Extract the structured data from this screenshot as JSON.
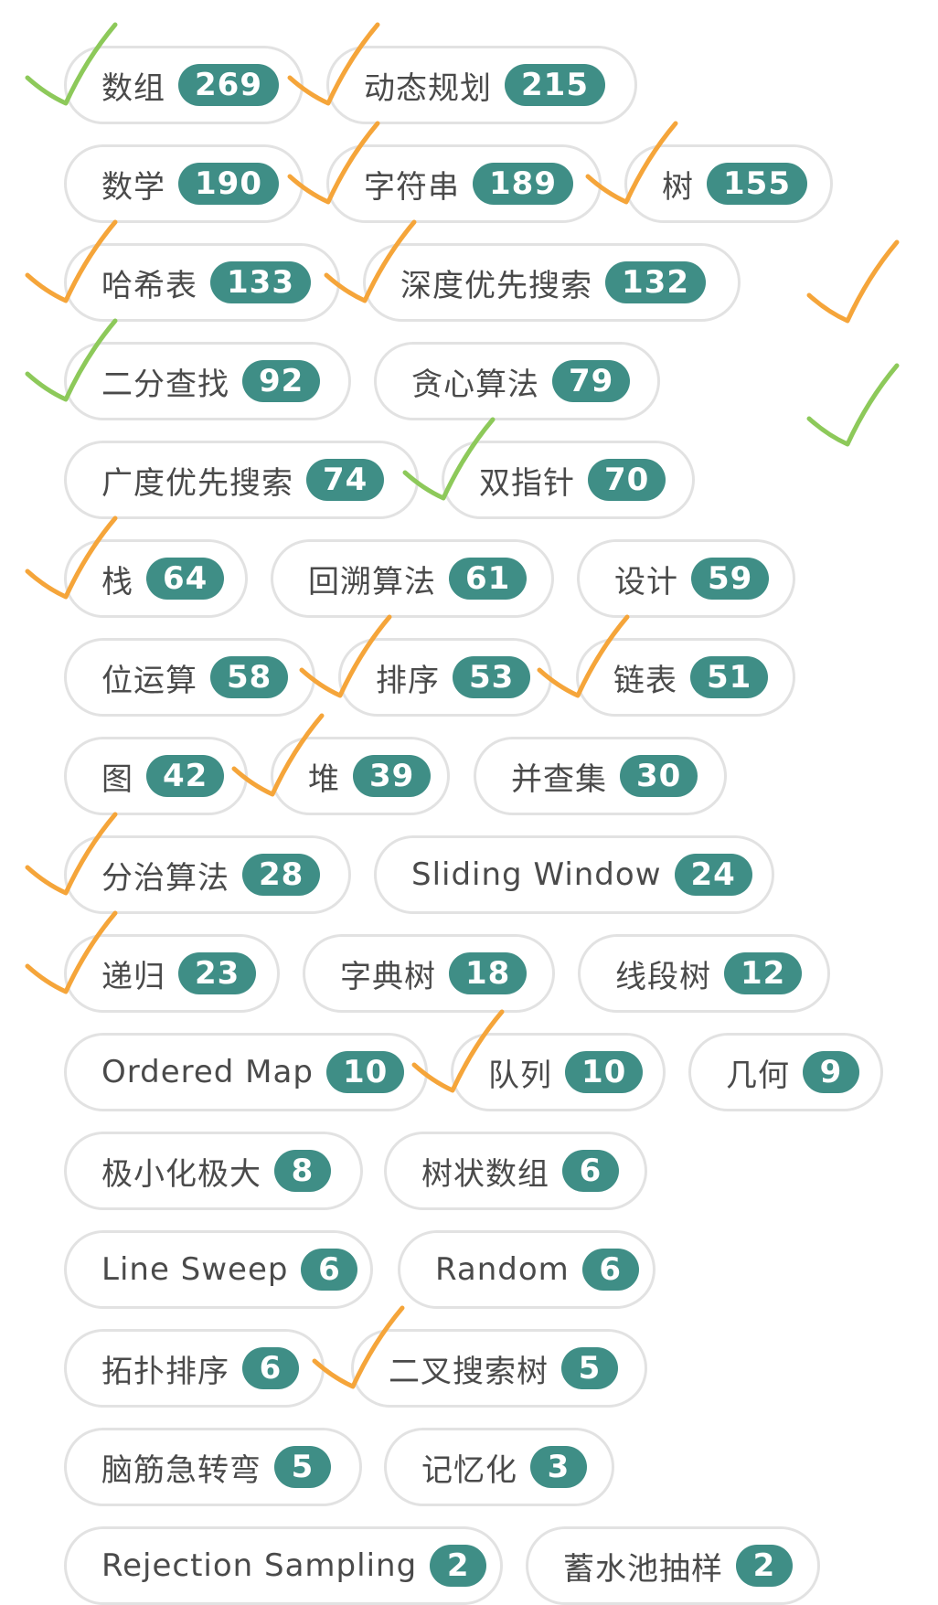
{
  "colors": {
    "accent": "#3f8e86",
    "orange_check": "#f5a53a",
    "green_check": "#8dc95a",
    "border": "#e2e2e2",
    "label": "#4a4a4a"
  },
  "tags": [
    {
      "label": "数组",
      "count": "269",
      "check": "green"
    },
    {
      "label": "动态规划",
      "count": "215",
      "check": "orange"
    },
    {
      "label": "数学",
      "count": "190",
      "check": null
    },
    {
      "label": "字符串",
      "count": "189",
      "check": "orange"
    },
    {
      "label": "树",
      "count": "155",
      "check": "orange"
    },
    {
      "label": "哈希表",
      "count": "133",
      "check": "orange"
    },
    {
      "label": "深度优先搜索",
      "count": "132",
      "check": "orange"
    },
    {
      "label": "二分查找",
      "count": "92",
      "check": "green"
    },
    {
      "label": "贪心算法",
      "count": "79",
      "check": null
    },
    {
      "label": "广度优先搜索",
      "count": "74",
      "check": null
    },
    {
      "label": "双指针",
      "count": "70",
      "check": "green"
    },
    {
      "label": "栈",
      "count": "64",
      "check": "orange"
    },
    {
      "label": "回溯算法",
      "count": "61",
      "check": null
    },
    {
      "label": "设计",
      "count": "59",
      "check": null
    },
    {
      "label": "位运算",
      "count": "58",
      "check": null
    },
    {
      "label": "排序",
      "count": "53",
      "check": "orange"
    },
    {
      "label": "链表",
      "count": "51",
      "check": "orange"
    },
    {
      "label": "图",
      "count": "42",
      "check": null
    },
    {
      "label": "堆",
      "count": "39",
      "check": "orange"
    },
    {
      "label": "并查集",
      "count": "30",
      "check": null
    },
    {
      "label": "分治算法",
      "count": "28",
      "check": "orange"
    },
    {
      "label": "Sliding Window",
      "count": "24",
      "check": null
    },
    {
      "label": "递归",
      "count": "23",
      "check": "orange"
    },
    {
      "label": "字典树",
      "count": "18",
      "check": null
    },
    {
      "label": "线段树",
      "count": "12",
      "check": null
    },
    {
      "label": "Ordered Map",
      "count": "10",
      "check": null
    },
    {
      "label": "队列",
      "count": "10",
      "check": "orange"
    },
    {
      "label": "几何",
      "count": "9",
      "check": null
    },
    {
      "label": "极小化极大",
      "count": "8",
      "check": null
    },
    {
      "label": "树状数组",
      "count": "6",
      "check": null
    },
    {
      "label": "Line Sweep",
      "count": "6",
      "check": null
    },
    {
      "label": "Random",
      "count": "6",
      "check": null
    },
    {
      "label": "拓扑排序",
      "count": "6",
      "check": null
    },
    {
      "label": "二叉搜索树",
      "count": "5",
      "check": "orange"
    },
    {
      "label": "脑筋急转弯",
      "count": "5",
      "check": null
    },
    {
      "label": "记忆化",
      "count": "3",
      "check": null
    },
    {
      "label": "Rejection Sampling",
      "count": "2",
      "check": null
    },
    {
      "label": "蓄水池抽样",
      "count": "2",
      "check": null
    }
  ],
  "free_checks": [
    {
      "color": "orange",
      "semantic": "checkmark-icon"
    },
    {
      "color": "green",
      "semantic": "checkmark-icon"
    }
  ]
}
